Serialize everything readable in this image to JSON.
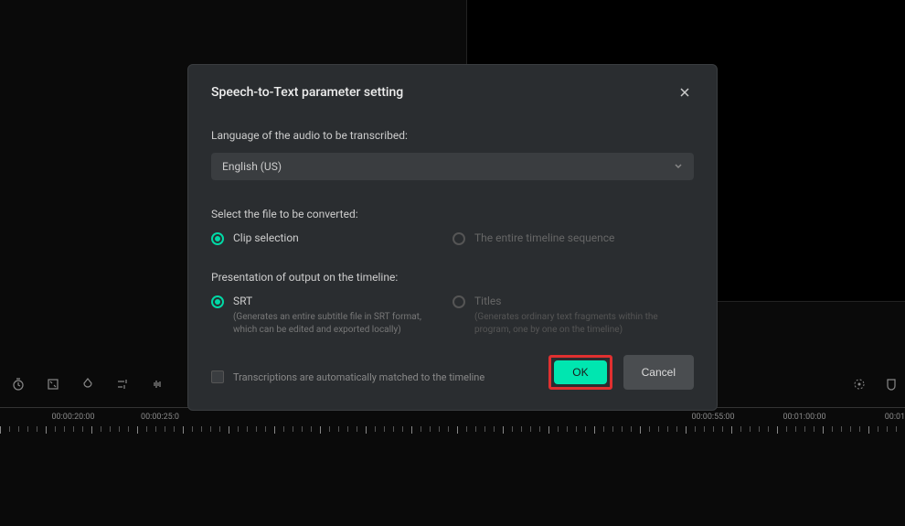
{
  "dialog": {
    "title": "Speech-to-Text parameter setting",
    "language_label": "Language of the audio to be transcribed:",
    "language_value": "English (US)",
    "file_select_label": "Select the file to be converted:",
    "file_options": {
      "clip": "Clip selection",
      "timeline": "The entire timeline sequence"
    },
    "output_label": "Presentation of output on the timeline:",
    "output_options": {
      "srt": {
        "label": "SRT",
        "description": "(Generates an entire subtitle file in SRT format, which can be edited and exported locally)"
      },
      "titles": {
        "label": "Titles",
        "description": "(Generates ordinary text fragments within the program, one by one on the timeline)"
      }
    },
    "auto_match_label": "Transcriptions are automatically matched to the timeline",
    "buttons": {
      "ok": "OK",
      "cancel": "Cancel"
    }
  },
  "timeline": {
    "times": [
      "00:00:20:00",
      "00:00:25:0",
      "00:00:55:00",
      "00:01:00:00",
      "00:01:"
    ]
  }
}
